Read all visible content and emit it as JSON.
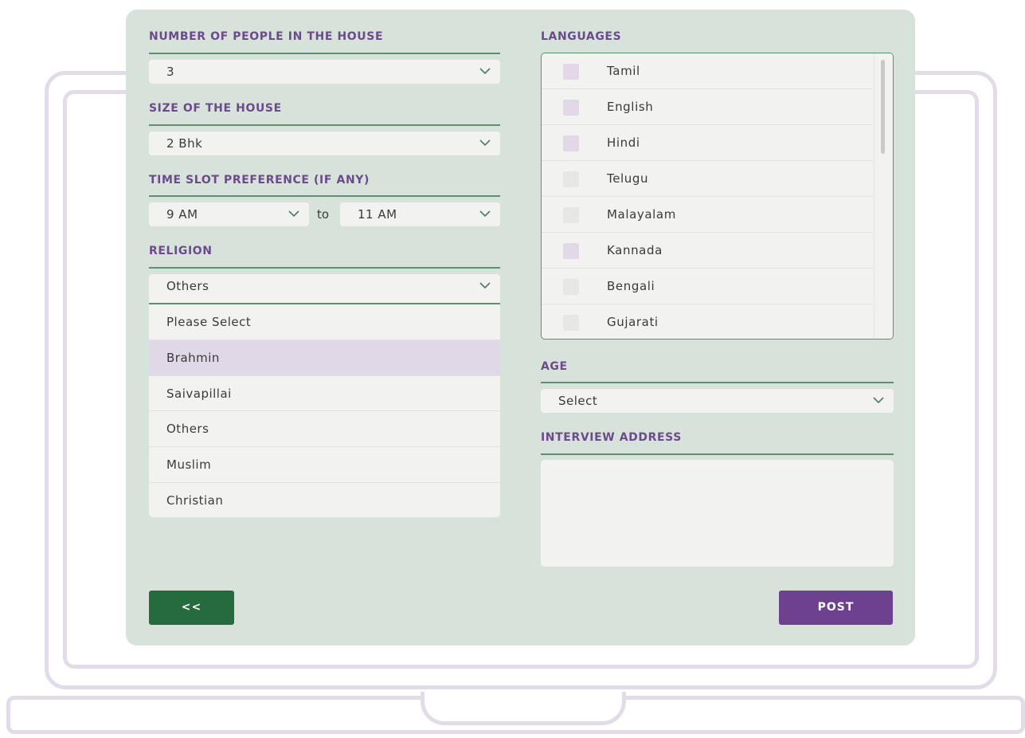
{
  "form": {
    "people_label": "NUMBER OF PEOPLE IN THE HOUSE",
    "people_value": "3",
    "size_label": "SIZE OF THE HOUSE",
    "size_value": "2 Bhk",
    "timeslot_label": "TIME SLOT PREFERENCE (IF ANY)",
    "timeslot_from": "9 AM",
    "timeslot_to_word": "to",
    "timeslot_to": "11 AM",
    "religion_label": "RELIGION",
    "religion_value": "Others",
    "religion_options": [
      "Please Select",
      "Brahmin",
      "Saivapillai",
      "Others",
      "Muslim",
      "Christian"
    ],
    "languages_label": "LANGUAGES",
    "languages": [
      "Tamil",
      "English",
      "Hindi",
      "Telugu",
      "Malayalam",
      "Kannada",
      "Bengali",
      "Gujarati"
    ],
    "age_label": "AGE",
    "age_value": "Select",
    "address_label": "INTERVIEW ADDRESS",
    "address_value": ""
  },
  "buttons": {
    "back": "<<",
    "post": "POST"
  },
  "colors": {
    "card_bg": "#d7e2da",
    "label": "#6c4a8c",
    "rule": "#5e8f6e",
    "back_button": "#256b3e",
    "post_button": "#6d418d",
    "highlight": "#e0d8e6",
    "laptop_outline": "#e4dbe9"
  },
  "icons": {
    "dropdown": "chevron-down-icon",
    "checkbox": "checkbox-icon"
  }
}
